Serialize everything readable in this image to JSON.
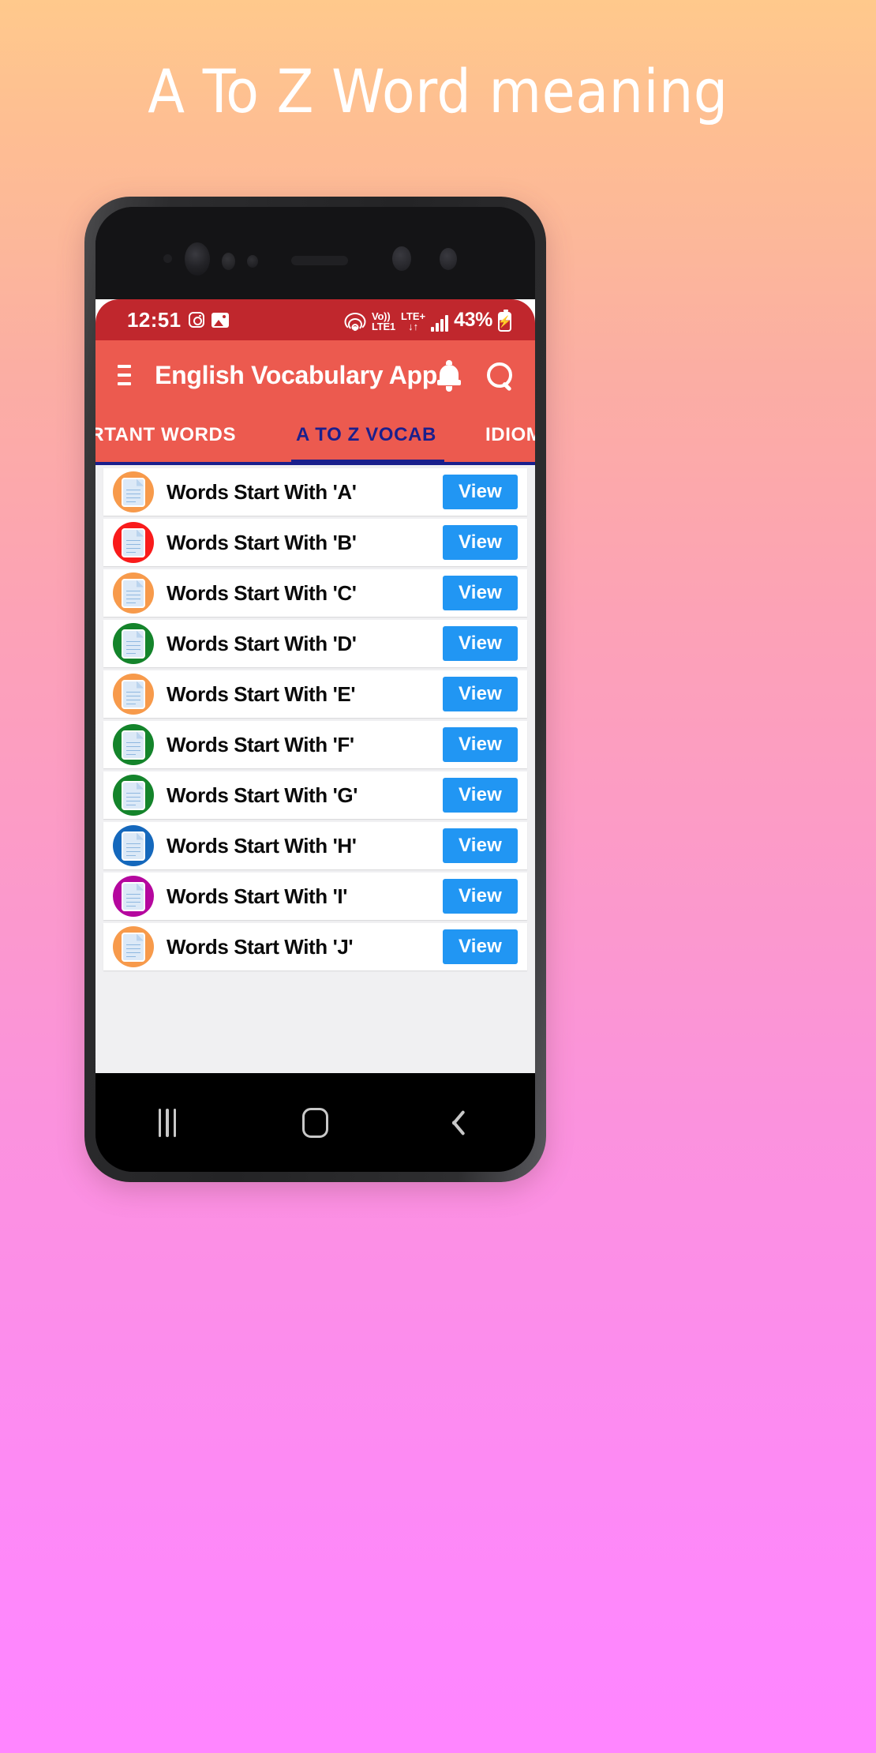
{
  "hero": {
    "title": "A To Z Word meaning"
  },
  "status_bar": {
    "time": "12:51",
    "left_icons": [
      "instagram-icon",
      "photos-icon"
    ],
    "hotspot_icon": "hotspot-icon",
    "volte_line1": "Vo))",
    "volte_line2": "LTE1",
    "lte_line1": "LTE+",
    "lte_line2": "↓↑",
    "signal_icon": "signal-bars-icon",
    "battery_percent": "43%",
    "battery_icon": "battery-charging-icon"
  },
  "app_bar": {
    "menu_icon": "hamburger-menu-icon",
    "title": "English Vocabulary App",
    "bell_icon": "notification-bell-icon",
    "search_icon": "search-icon"
  },
  "tabs": [
    {
      "label": "ORTANT WORDS",
      "active": false
    },
    {
      "label": "A TO Z VOCAB",
      "active": true
    },
    {
      "label": "IDIOMS & PHRAS",
      "active": false
    }
  ],
  "colors": {
    "status_bar_bg": "#C0272D",
    "app_bar_bg": "#EC5A4F",
    "tab_active": "#1A1F8C",
    "view_button": "#2196F3",
    "orange": "#F79A4B",
    "red": "#F91B1B",
    "green": "#14842B",
    "blue": "#1568BC",
    "magenta": "#B5079E"
  },
  "list": {
    "view_label": "View",
    "rows": [
      {
        "label": "Words Start With 'A'",
        "color": "#F79A4B",
        "icon": "document-icon"
      },
      {
        "label": "Words Start With 'B'",
        "color": "#F91B1B",
        "icon": "document-icon"
      },
      {
        "label": "Words Start With 'C'",
        "color": "#F79A4B",
        "icon": "document-icon"
      },
      {
        "label": "Words Start With 'D'",
        "color": "#14842B",
        "icon": "document-icon"
      },
      {
        "label": "Words Start With 'E'",
        "color": "#F79A4B",
        "icon": "document-icon"
      },
      {
        "label": "Words Start With 'F'",
        "color": "#14842B",
        "icon": "document-icon"
      },
      {
        "label": "Words Start With 'G'",
        "color": "#14842B",
        "icon": "document-icon"
      },
      {
        "label": "Words Start With 'H'",
        "color": "#1568BC",
        "icon": "document-icon"
      },
      {
        "label": "Words Start With 'I'",
        "color": "#B5079E",
        "icon": "document-icon"
      },
      {
        "label": "Words Start With 'J'",
        "color": "#F79A4B",
        "icon": "document-icon"
      }
    ]
  },
  "nav_bar": {
    "recents_icon": "recents-icon",
    "home_icon": "home-icon",
    "back_icon": "back-icon"
  }
}
